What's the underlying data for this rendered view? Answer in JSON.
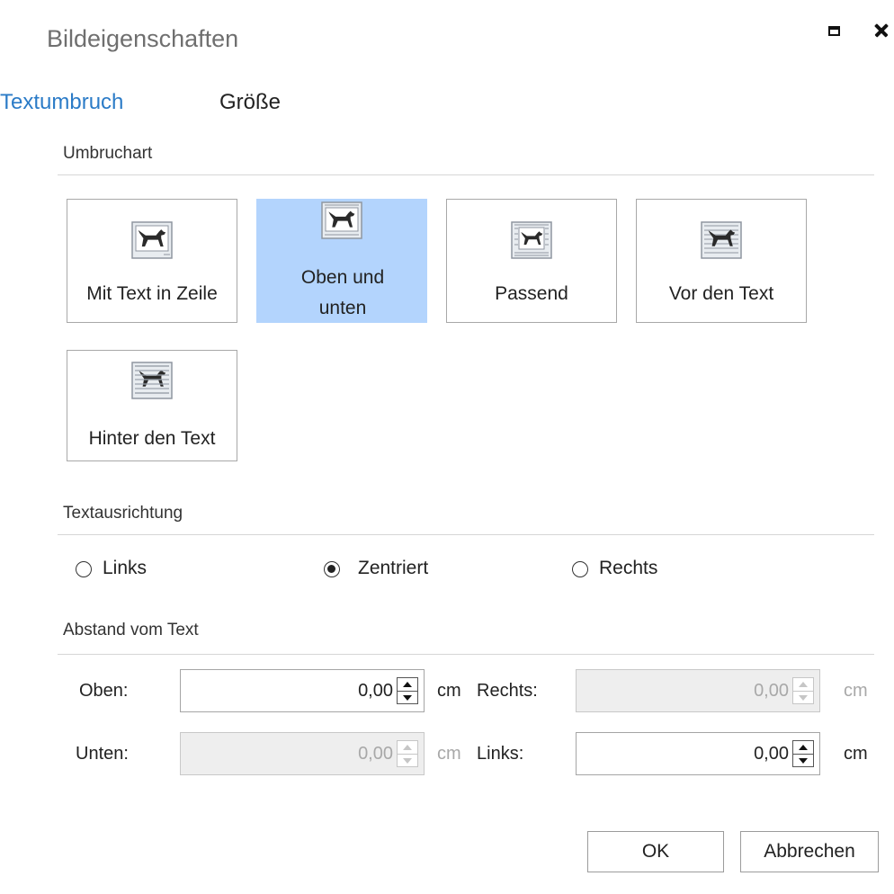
{
  "window": {
    "title": "Bildeigenschaften",
    "maximize_icon": "maximize-icon",
    "close_icon": "close-icon"
  },
  "tabs": [
    {
      "label": "Textumbruch",
      "active": true
    },
    {
      "label": "Größe",
      "active": false
    }
  ],
  "wrap": {
    "section_label": "Umbruchart",
    "options": [
      {
        "label": "Mit Text in Zeile",
        "icon": "wrap-inline-icon",
        "selected": false
      },
      {
        "label": "Oben und unten",
        "icon": "wrap-top-bottom-icon",
        "selected": true
      },
      {
        "label": "Passend",
        "icon": "wrap-square-icon",
        "selected": false
      },
      {
        "label": "Vor den Text",
        "icon": "wrap-in-front-icon",
        "selected": false
      },
      {
        "label": "Hinter den Text",
        "icon": "wrap-behind-icon",
        "selected": false
      }
    ]
  },
  "alignment": {
    "section_label": "Textausrichtung",
    "options": [
      {
        "label": "Links",
        "checked": false
      },
      {
        "label": "Zentriert",
        "checked": true
      },
      {
        "label": "Rechts",
        "checked": false
      }
    ]
  },
  "distance": {
    "section_label": "Abstand vom Text",
    "fields": {
      "top": {
        "label": "Oben:",
        "value": "0,00",
        "unit": "cm",
        "enabled": true
      },
      "right": {
        "label": "Rechts:",
        "value": "0,00",
        "unit": "cm",
        "enabled": false
      },
      "bottom": {
        "label": "Unten:",
        "value": "0,00",
        "unit": "cm",
        "enabled": false
      },
      "left": {
        "label": "Links:",
        "value": "0,00",
        "unit": "cm",
        "enabled": true
      }
    }
  },
  "buttons": {
    "ok": "OK",
    "cancel": "Abbrechen"
  },
  "colors": {
    "accent": "#2b7bc7",
    "selected_background": "#b3d4fd",
    "disabled_field": "#eeeeee"
  }
}
